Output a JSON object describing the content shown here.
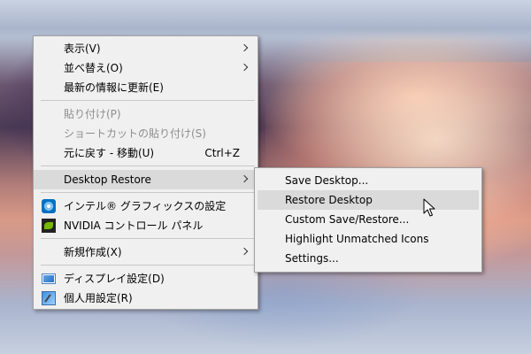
{
  "context_menu": {
    "view": "表示(V)",
    "sort_by": "並べ替え(O)",
    "refresh": "最新の情報に更新(E)",
    "paste": "貼り付け(P)",
    "paste_shortcut": "ショートカットの貼り付け(S)",
    "undo": "元に戻す - 移動(U)",
    "undo_shortcut": "Ctrl+Z",
    "desktop_restore": "Desktop Restore",
    "intel_graphics": "インテル® グラフィックスの設定",
    "nvidia": "NVIDIA コントロール パネル",
    "new": "新規作成(X)",
    "display_settings": "ディスプレイ設定(D)",
    "personalize": "個人用設定(R)"
  },
  "submenu": {
    "save_desktop": "Save Desktop...",
    "restore_desktop": "Restore Desktop",
    "custom_save_restore": "Custom Save/Restore...",
    "highlight_unmatched": "Highlight Unmatched Icons",
    "settings": "Settings..."
  },
  "colors": {
    "menu_background": "#f0f0f0",
    "highlight": "#dadada",
    "disabled_text": "#8d8d8d"
  },
  "icons": [
    "intel-graphics-icon",
    "nvidia-icon",
    "display-settings-icon",
    "personalize-icon",
    "submenu-arrow-icon",
    "mouse-cursor-icon"
  ]
}
